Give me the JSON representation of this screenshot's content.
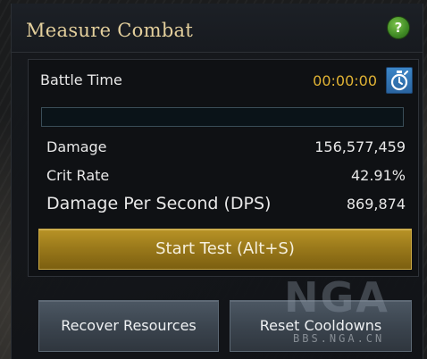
{
  "window": {
    "title": "Measure Combat",
    "help_label": "?"
  },
  "timer": {
    "label": "Battle Time",
    "value": "00:00:00",
    "icon": "stopwatch-icon",
    "progress": 0
  },
  "stats": {
    "damage_label": "Damage",
    "damage_value": "156,577,459",
    "crit_label": "Crit Rate",
    "crit_value": "42.91%",
    "dps_label": "Damage Per Second (DPS)",
    "dps_value": "869,874"
  },
  "buttons": {
    "start": "Start Test (Alt+S)",
    "recover": "Recover Resources",
    "reset": "Reset Cooldowns"
  },
  "watermark": {
    "logo": "NGA",
    "site": "BBS.NGA.CN"
  },
  "colors": {
    "title_gold": "#e3cf9c",
    "timer_gold": "#e0b334",
    "start_button": "#9b7a1b",
    "secondary_button": "#3a434d",
    "help_green": "#3f8a24",
    "stopwatch_blue": "#2f6fad"
  }
}
